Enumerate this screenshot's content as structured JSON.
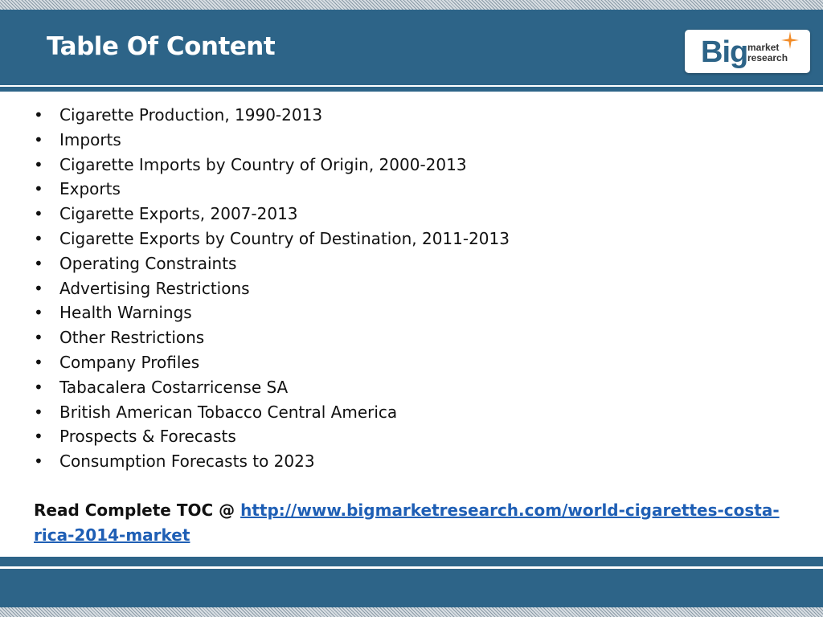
{
  "header": {
    "title": "Table Of Content",
    "logo": {
      "big": "Big",
      "line1": "market",
      "line2": "research",
      "accent": "#f28c28"
    }
  },
  "toc": {
    "bullet": "•",
    "items": [
      "Cigarette Production, 1990-2013",
      "Imports",
      "Cigarette Imports by Country of Origin, 2000-2013",
      "Exports",
      "Cigarette Exports, 2007-2013",
      "Cigarette Exports by Country of Destination, 2011-2013",
      "Operating Constraints",
      "Advertising Restrictions",
      "Health Warnings",
      "Other Restrictions",
      "Company Profiles",
      "Tabacalera Costarricense SA",
      "British American Tobacco Central America",
      "Prospects & Forecasts",
      "Consumption Forecasts to 2023"
    ]
  },
  "read_more": {
    "label": "Read Complete TOC @ ",
    "link_text": "http://www.bigmarketresearch.com/world-cigarettes-costa-rica-2014-market",
    "link_href": "http://www.bigmarketresearch.com/world-cigarettes-costa-rica-2014-market"
  },
  "colors": {
    "band": "#2d6488",
    "link": "#1f5fb5"
  }
}
